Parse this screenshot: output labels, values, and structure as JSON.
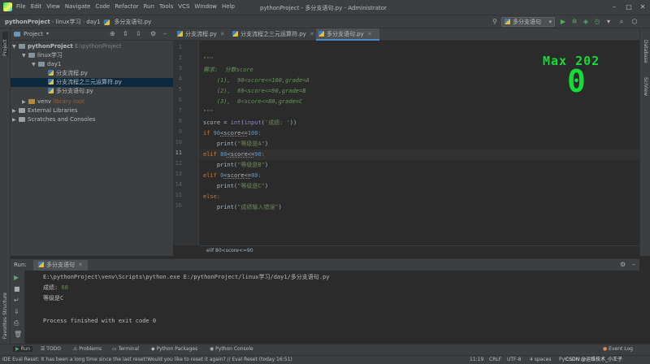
{
  "titlebar": {
    "menu": [
      "File",
      "Edit",
      "View",
      "Navigate",
      "Code",
      "Refactor",
      "Run",
      "Tools",
      "VCS",
      "Window",
      "Help"
    ],
    "title": "pythonProject - 多分支语句.py - Administrator"
  },
  "navbar": {
    "crumbs": [
      "pythonProject",
      "linux学习",
      "day1",
      "多分支语句.py"
    ],
    "run_config": "多分支语句"
  },
  "project_panel": {
    "title": "Project",
    "tree": [
      {
        "label": "pythonProject",
        "hint": "E:\\pythonProject"
      },
      {
        "label": "linux学习"
      },
      {
        "label": "day1"
      },
      {
        "label": "分支流程.py"
      },
      {
        "label": "分支流程之三元运算符.py"
      },
      {
        "label": "多分支语句.py"
      },
      {
        "label": "venv",
        "hint": "library root"
      },
      {
        "label": "External Libraries"
      },
      {
        "label": "Scratches and Consoles"
      }
    ]
  },
  "editor": {
    "tabs": [
      "分支流程.py",
      "分支流程之三元运算符.py",
      "多分支语句.py"
    ],
    "line_numbers": [
      "1",
      "2",
      "3",
      "4",
      "5",
      "6",
      "7",
      "8",
      "9",
      "10",
      "11",
      "12",
      "13",
      "14",
      "15",
      "16"
    ],
    "lines": {
      "l2": "\"\"\"",
      "l3": "需求:  分数score",
      "l4": "    (1),  90<score<=100,grade=A",
      "l5": "    (2),  80<score<=90,grade=B",
      "l6": "    (3),  0<score<=80,grade=C",
      "l7": "\"\"\"",
      "l8a": "score = ",
      "l8b": "int",
      "l8c": "(",
      "l8d": "input",
      "l8e": "(",
      "l8f": "'成绩: '",
      "l8g": "))",
      "l9a": "if ",
      "l9b": "90",
      "l9c": "<score<=",
      "l9d": "100",
      "l9e": ":",
      "l10a": "    print(",
      "l10b": "\"等级是A\"",
      "l10c": ")",
      "l11a": "elif ",
      "l11b": "80",
      "l11c": "<score<=",
      "l11d": "90",
      "l11e": ":",
      "l12a": "    print(",
      "l12b": "\"等级是B\"",
      "l12c": ")",
      "l13a": "elif ",
      "l13b": "0",
      "l13c": "<score<=",
      "l13d": "80",
      "l13e": ":",
      "l14a": "    print(",
      "l14b": "\"等级是C\"",
      "l14c": ")",
      "l15a": "else",
      "l15b": ":",
      "l16a": "    print(",
      "l16b": "\"成绩输入错误\"",
      "l16c": ")"
    },
    "breadcrumb": "elif 80<score<=90"
  },
  "overlay": {
    "max_label": "Max 202",
    "score": "0"
  },
  "run_panel": {
    "label": "Run:",
    "tab": "多分支语句",
    "output": {
      "cmd": "E:\\pythonProject\\venv\\Scripts\\python.exe E:/pythonProject/linux学习/day1/多分支语句.py",
      "prompt": "成绩: ",
      "input": "60",
      "result": "等级是C",
      "exit": "Process finished with exit code 0"
    }
  },
  "bottom_tools": [
    "Run",
    "TODO",
    "Problems",
    "Terminal",
    "Python Packages",
    "Python Console",
    "Event Log"
  ],
  "statusbar": {
    "message": "IDE Eval Reset: It has been a long time since the last reset!Would you like to reset it again? // Eval Reset (today 16:51)",
    "position": "11:19",
    "line_sep": "CRLF",
    "encoding": "UTF-8",
    "indent": "4 spaces",
    "interpreter": "Python 3.9",
    "watermark": "CSDN @运维技术_小王子"
  },
  "stripes": {
    "left": [
      "Project",
      "Structure",
      "Favorites"
    ],
    "right": [
      "Database",
      "SciView"
    ]
  },
  "colors": {
    "accent": "#4a88c7",
    "overlay_green": "#11dd33"
  }
}
